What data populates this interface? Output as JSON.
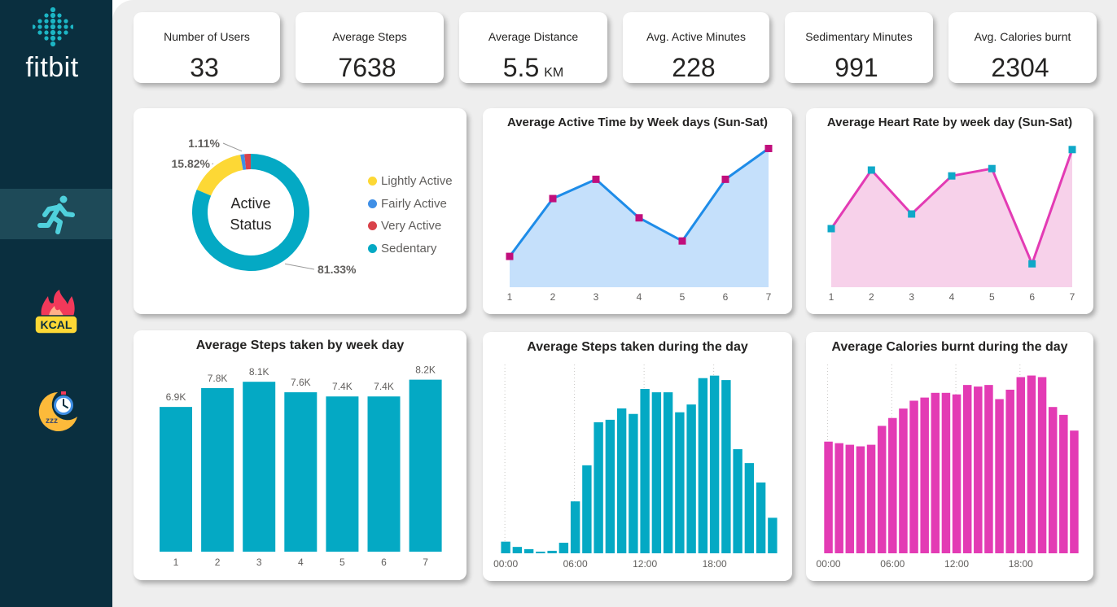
{
  "brand": {
    "name": "fitbit"
  },
  "nav": [
    {
      "icon": "running-person-icon",
      "active": true
    },
    {
      "icon": "kcal-flame-icon",
      "active": false,
      "badge": "KCAL"
    },
    {
      "icon": "sleep-moon-icon",
      "active": false,
      "badge": "zzz"
    }
  ],
  "kpis": [
    {
      "label": "Number of Users",
      "value": "33",
      "unit": ""
    },
    {
      "label": "Average Steps",
      "value": "7638",
      "unit": ""
    },
    {
      "label": "Average Distance",
      "value": "5.5",
      "unit": "KM"
    },
    {
      "label": "Avg. Active Minutes",
      "value": "228",
      "unit": ""
    },
    {
      "label": "Sedimentary Minutes",
      "value": "991",
      "unit": ""
    },
    {
      "label": "Avg. Calories burnt",
      "value": "2304",
      "unit": ""
    }
  ],
  "chart_data": [
    {
      "id": "active-status",
      "type": "pie",
      "title": "",
      "center_label": [
        "Active",
        "Status"
      ],
      "labels": [
        "Lightly Active",
        "Fairly Active",
        "Very Active",
        "Sedentary"
      ],
      "values": [
        15.82,
        1.11,
        1.74,
        81.33
      ],
      "value_labels": [
        "15.82%",
        "1.11%",
        "",
        "81.33%"
      ],
      "colors": [
        "#fdd835",
        "#3f8fe6",
        "#d9424a",
        "#04a9c4"
      ],
      "legend": "right"
    },
    {
      "id": "active-time-weekday",
      "type": "area",
      "title": "Average Active Time by Week days (Sun-Sat)",
      "x": [
        1,
        2,
        3,
        4,
        5,
        6,
        7
      ],
      "values": [
        212,
        227,
        232,
        222,
        216,
        232,
        240
      ],
      "ylim": [
        204,
        242
      ],
      "line_color": "#1e8ce8",
      "fill_color": "#c5e0fb",
      "marker_color": "#c10e7c"
    },
    {
      "id": "heart-rate-weekday",
      "type": "area",
      "title": "Average Heart Rate by week day (Sun-Sat)",
      "x": [
        1,
        2,
        3,
        4,
        5,
        6,
        7
      ],
      "values": [
        79,
        83,
        80,
        82.6,
        83.1,
        76.6,
        84.4
      ],
      "ylim": [
        75,
        85
      ],
      "line_color": "#e33bb4",
      "fill_color": "#f7d1ea",
      "marker_color": "#0fa8c8"
    },
    {
      "id": "steps-weekday",
      "type": "bar",
      "title": "Average Steps taken by week day",
      "categories": [
        "1",
        "2",
        "3",
        "4",
        "5",
        "6",
        "7"
      ],
      "values": [
        6900,
        7800,
        8100,
        7600,
        7400,
        7400,
        8200
      ],
      "value_labels": [
        "6.9K",
        "7.8K",
        "8.1K",
        "7.6K",
        "7.4K",
        "7.4K",
        "8.2K"
      ],
      "ylim": [
        0,
        9000
      ],
      "color": "#04a9c4"
    },
    {
      "id": "steps-hour",
      "type": "bar",
      "title": "Average Steps taken during the day",
      "x": [
        0,
        1,
        2,
        3,
        4,
        5,
        6,
        7,
        8,
        9,
        10,
        11,
        12,
        13,
        14,
        15,
        16,
        17,
        18,
        19,
        20,
        21,
        22,
        23
      ],
      "values": [
        42,
        23,
        15,
        6,
        9,
        38,
        187,
        317,
        472,
        481,
        522,
        502,
        592,
        580,
        580,
        508,
        536,
        631,
        640,
        624,
        375,
        325,
        255,
        128
      ],
      "xticks": [
        "00:00",
        "06:00",
        "12:00",
        "18:00"
      ],
      "ylim": [
        0,
        680
      ],
      "color": "#04a9c4"
    },
    {
      "id": "calories-hour",
      "type": "bar",
      "title": "Average Calories burnt during the day",
      "x": [
        0,
        1,
        2,
        3,
        4,
        5,
        6,
        7,
        8,
        9,
        10,
        11,
        12,
        13,
        14,
        15,
        16,
        17,
        18,
        19,
        20,
        21,
        22,
        23
      ],
      "values": [
        71,
        70,
        69,
        68,
        69,
        81,
        86,
        92,
        97,
        99,
        102,
        102,
        101,
        107,
        106,
        107,
        98,
        104,
        112,
        113,
        112,
        93,
        88,
        78
      ],
      "xticks": [
        "00:00",
        "06:00",
        "12:00",
        "18:00"
      ],
      "ylim": [
        0,
        120
      ],
      "color": "#e33bb4"
    }
  ]
}
